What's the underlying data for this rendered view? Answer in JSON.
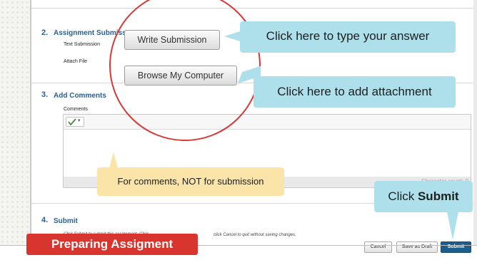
{
  "section2": {
    "number": "2.",
    "title": "Assignment Submiss",
    "text_submission_label": "Text Submission",
    "attach_file_label": "Attach File",
    "write_button": "Write Submission",
    "browse_button": "Browse My Computer"
  },
  "section3": {
    "number": "3.",
    "title": "Add Comments",
    "comments_label": "Comments",
    "spellcheck_dropdown": "▾",
    "character_count": "Character count: 0"
  },
  "section4": {
    "number": "4.",
    "title": "Submit",
    "instruction_left": "Click Submit to submit this assignment. Click",
    "instruction_right": "click Cancel to quit without saving changes."
  },
  "buttons": {
    "cancel": "Cancel",
    "save_draft": "Save as Draft",
    "submit": "Submit"
  },
  "callouts": {
    "type_answer": "Click here to type your answer",
    "add_attachment": "Click here to add attachment",
    "comments_note": "For comments, NOT for submission",
    "click_prefix": "Click ",
    "click_bold": "Submit"
  },
  "banner": {
    "title": "Preparing Assigment"
  },
  "colors": {
    "callout_blue": "#aee0ec",
    "callout_yellow": "#fbe4a8",
    "banner_red": "#d9352f",
    "circle_red": "#d53a3a",
    "submit_blue": "#1d5d8c",
    "heading_blue": "#2c5e8f"
  }
}
